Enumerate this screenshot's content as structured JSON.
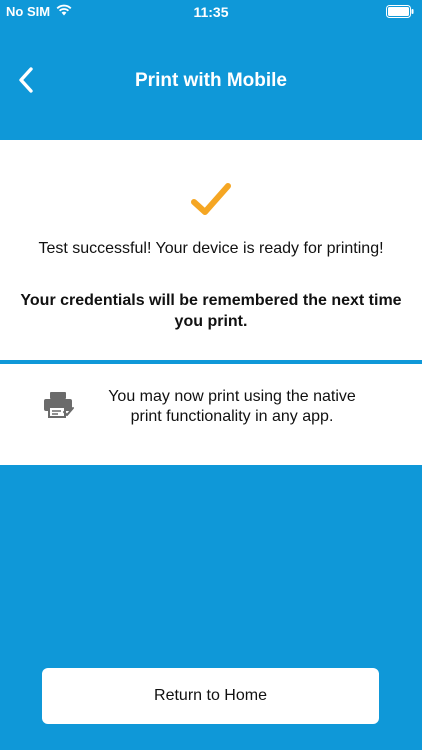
{
  "status_bar": {
    "carrier": "No SIM",
    "time": "11:35",
    "icons": [
      "wifi-icon",
      "battery-icon"
    ]
  },
  "nav": {
    "title": "Print with Mobile",
    "back_icon": "chevron-left-icon"
  },
  "success": {
    "icon": "checkmark-icon",
    "message": "Test successful! Your device is ready for printing!",
    "credentials_note": "Your credentials will be remembered the next time you print."
  },
  "info": {
    "icon": "printer-check-icon",
    "text": "You may now print using the native print functionality in any app."
  },
  "actions": {
    "return_home_label": "Return to Home"
  },
  "colors": {
    "background": "#0f98d8",
    "card": "#ffffff",
    "accent": "#f5a623",
    "icon_gray": "#6b6b6b"
  }
}
